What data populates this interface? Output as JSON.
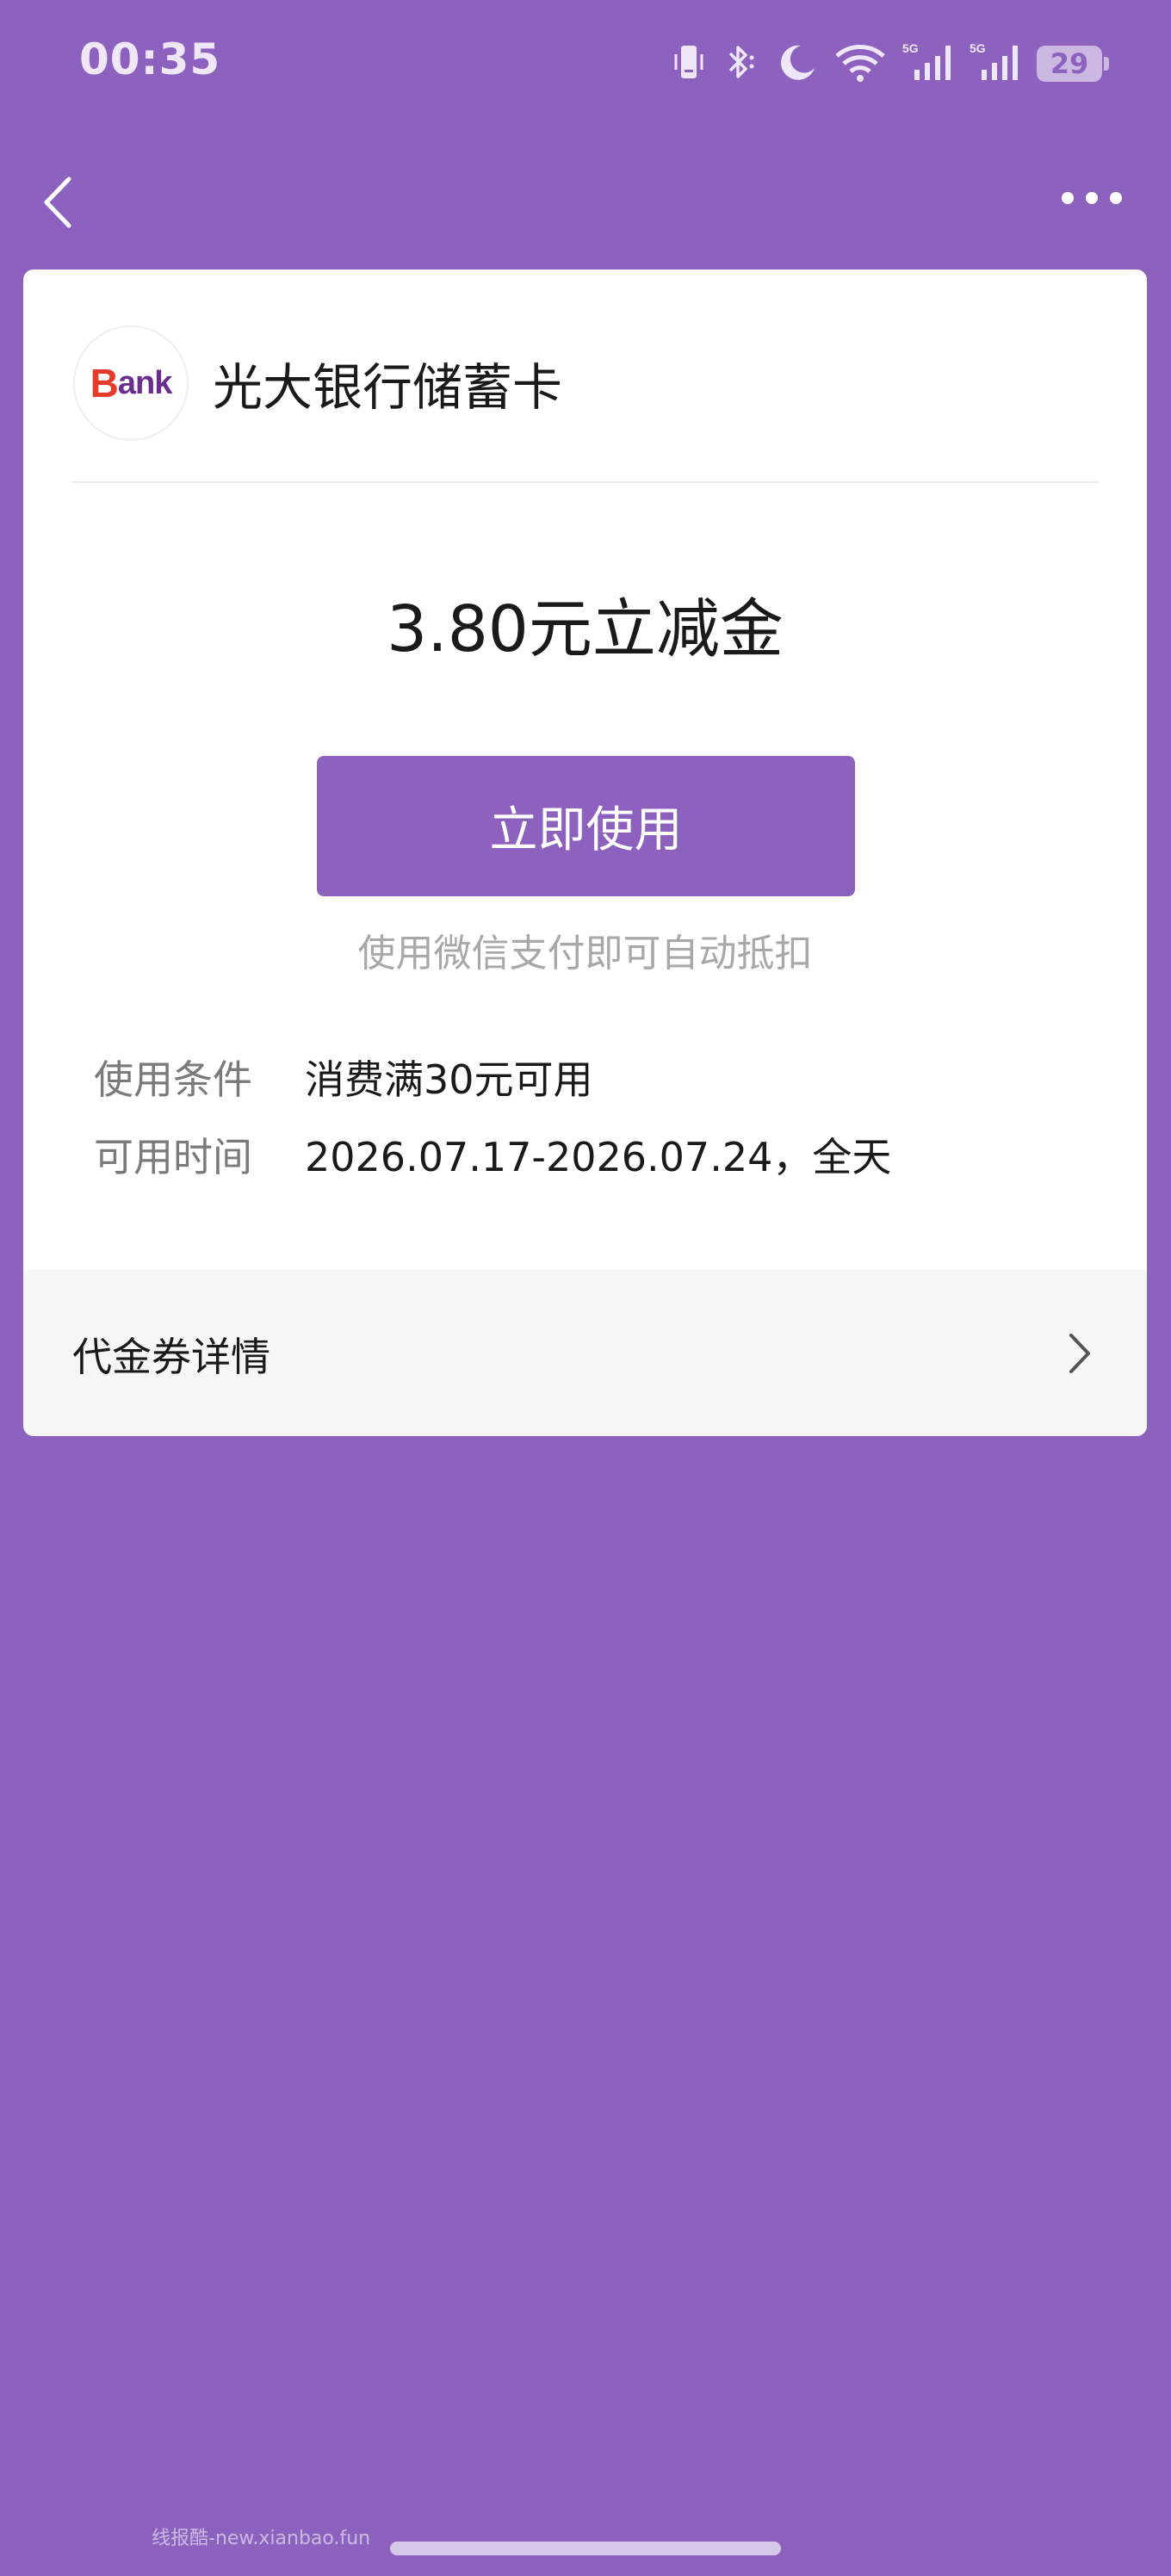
{
  "status_bar": {
    "time": "00:35",
    "icons": [
      "vibrate-icon",
      "bluetooth-icon",
      "moon-icon",
      "wifi-icon",
      "signal-5g-icon",
      "signal-5g-icon"
    ],
    "signal_label": "5G",
    "battery": "29"
  },
  "nav": {
    "back_icon": "chevron-left-icon",
    "more_icon": "more-dots-icon"
  },
  "card": {
    "logo_text_b": "B",
    "logo_text_rest": "ank",
    "bank_name": "光大银行储蓄卡",
    "amount": "3.80元立减金",
    "use_button": "立即使用",
    "hint": "使用微信支付即可自动抵扣",
    "conditions": [
      {
        "label": "使用条件",
        "value": "消费满30元可用"
      },
      {
        "label": "可用时间",
        "value": "2026.07.17-2026.07.24，全天"
      }
    ],
    "details_label": "代金券详情"
  },
  "watermark": "线报酷-new.xianbao.fun",
  "colors": {
    "background": "#8d62bf",
    "button": "#8d62bf",
    "card": "#ffffff"
  }
}
